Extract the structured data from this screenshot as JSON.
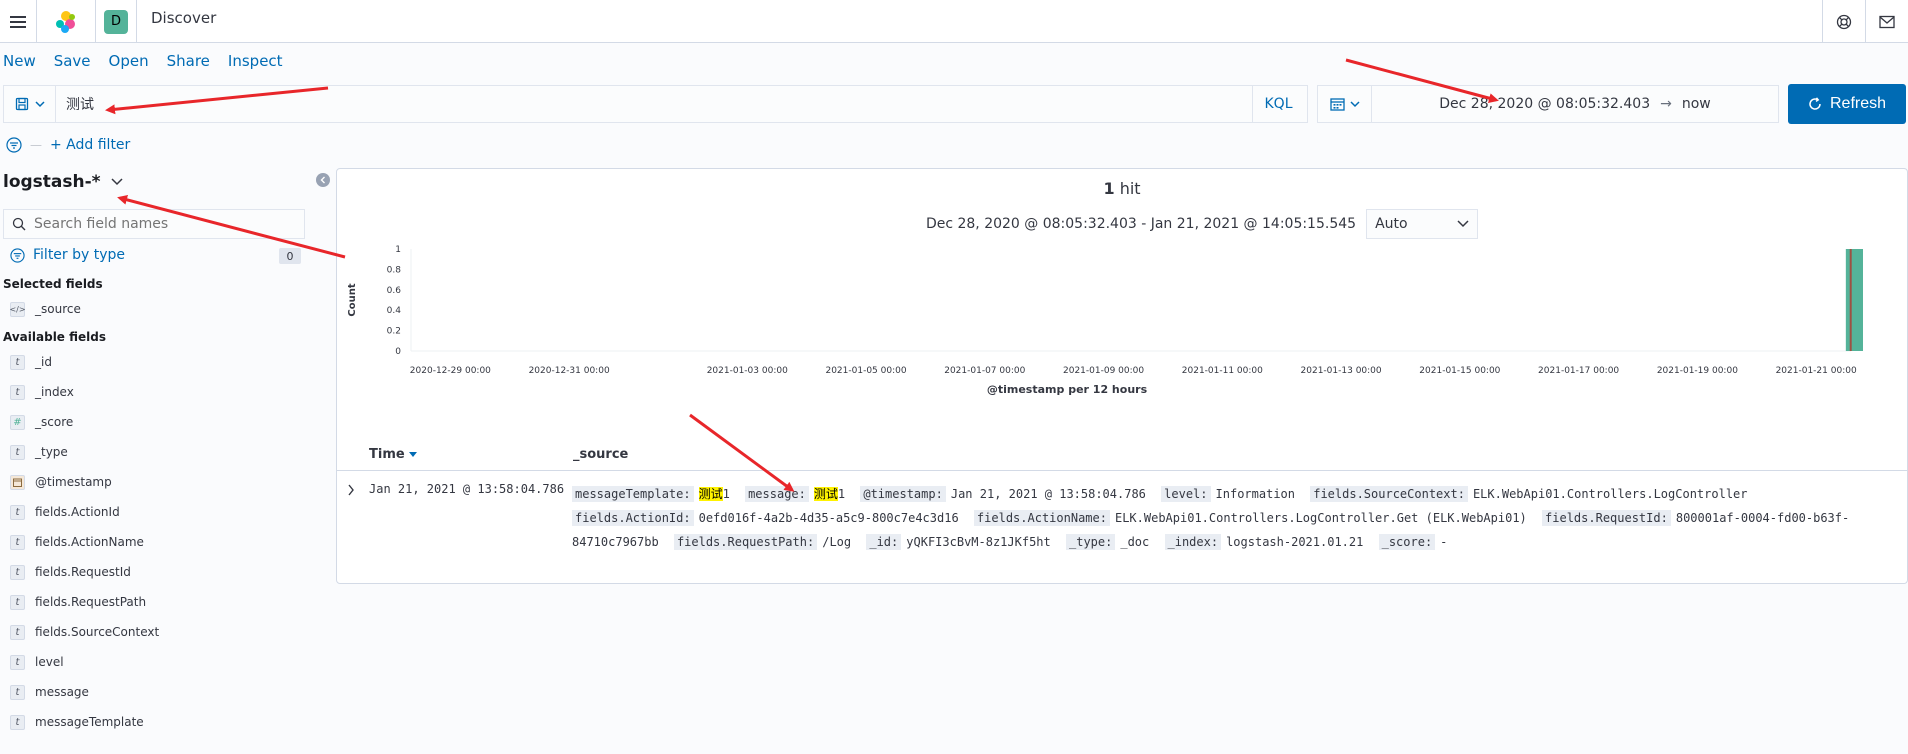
{
  "header": {
    "space_initial": "D",
    "title": "Discover"
  },
  "topnav": {
    "items": [
      {
        "label": "New"
      },
      {
        "label": "Save"
      },
      {
        "label": "Open"
      },
      {
        "label": "Share"
      },
      {
        "label": "Inspect"
      }
    ]
  },
  "query": {
    "value": "测试",
    "language_label": "KQL"
  },
  "timepicker": {
    "start": "Dec 28, 2020 @ 08:05:32.403",
    "arrow": "→",
    "end": "now",
    "refresh_label": "Refresh"
  },
  "filters": {
    "add_label": "+ Add filter"
  },
  "sidebar": {
    "index_pattern": "logstash-*",
    "search_placeholder": "Search field names",
    "filter_type_label": "Filter by type",
    "filter_count": "0",
    "selected_title": "Selected fields",
    "selected_fields": [
      {
        "name": "_source",
        "type": "source"
      }
    ],
    "available_title": "Available fields",
    "available_fields": [
      {
        "name": "_id",
        "type": "t"
      },
      {
        "name": "_index",
        "type": "t"
      },
      {
        "name": "_score",
        "type": "#"
      },
      {
        "name": "_type",
        "type": "t"
      },
      {
        "name": "@timestamp",
        "type": "date"
      },
      {
        "name": "fields.ActionId",
        "type": "t"
      },
      {
        "name": "fields.ActionName",
        "type": "t"
      },
      {
        "name": "fields.RequestId",
        "type": "t"
      },
      {
        "name": "fields.RequestPath",
        "type": "t"
      },
      {
        "name": "fields.SourceContext",
        "type": "t"
      },
      {
        "name": "level",
        "type": "t"
      },
      {
        "name": "message",
        "type": "t"
      },
      {
        "name": "messageTemplate",
        "type": "t"
      }
    ]
  },
  "results": {
    "hit_count": "1",
    "hit_label": "hit",
    "range_text": "Dec 28, 2020 @ 08:05:32.403 - Jan 21, 2021 @ 14:05:15.545",
    "interval": "Auto",
    "time_col": "Time",
    "source_col": "_source",
    "rows": [
      {
        "time": "Jan 21, 2021 @ 13:58:04.786",
        "fields": [
          {
            "k": "messageTemplate:",
            "v": "1",
            "hl": "测试"
          },
          {
            "k": "message:",
            "v": "1",
            "hl": "测试"
          },
          {
            "k": "@timestamp:",
            "v": "Jan 21, 2021 @ 13:58:04.786"
          },
          {
            "k": "level:",
            "v": "Information"
          },
          {
            "k": "fields.SourceContext:",
            "v": "ELK.WebApi01.Controllers.LogController"
          },
          {
            "k": "fields.ActionId:",
            "v": "0efd016f-4a2b-4d35-a5c9-800c7e4c3d16"
          },
          {
            "k": "fields.ActionName:",
            "v": "ELK.WebApi01.Controllers.LogController.Get (ELK.WebApi01)"
          },
          {
            "k": "fields.RequestId:",
            "v": "800001af-0004-fd00-b63f-84710c7967bb"
          },
          {
            "k": "fields.RequestPath:",
            "v": "/Log"
          },
          {
            "k": "_id:",
            "v": "yQKFI3cBvM-8z1JKf5ht"
          },
          {
            "k": "_type:",
            "v": "_doc"
          },
          {
            "k": "_index:",
            "v": "logstash-2021.01.21"
          },
          {
            "k": "_score:",
            "v": "-"
          }
        ]
      }
    ]
  },
  "chart_data": {
    "type": "bar",
    "title": "",
    "xlabel": "@timestamp per 12 hours",
    "ylabel": "Count",
    "x_ticks": [
      "2020-12-29 00:00",
      "2020-12-31 00:00",
      "2021-01-03 00:00",
      "2021-01-05 00:00",
      "2021-01-07 00:00",
      "2021-01-09 00:00",
      "2021-01-11 00:00",
      "2021-01-13 00:00",
      "2021-01-15 00:00",
      "2021-01-17 00:00",
      "2021-01-19 00:00",
      "2021-01-21 00:00"
    ],
    "y_ticks": [
      "0",
      "0.2",
      "0.4",
      "0.6",
      "0.8",
      "1"
    ],
    "ylim": [
      0,
      1
    ],
    "categories": [
      "2021-01-21 12:00"
    ],
    "values": [
      1
    ],
    "bar_color": "#54b399",
    "now_marker_color": "#bd271e"
  }
}
